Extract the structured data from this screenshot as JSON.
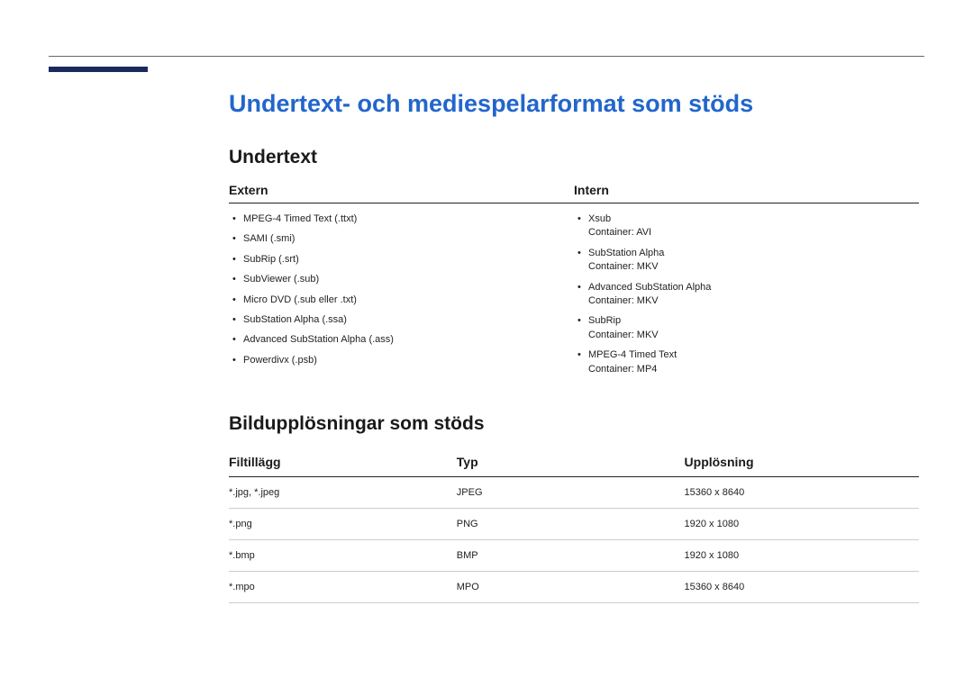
{
  "title": "Undertext- och mediespelarformat som stöds",
  "section_subtitle": "Undertext",
  "extern": {
    "heading": "Extern",
    "items": [
      "MPEG-4 Timed Text (.ttxt)",
      "SAMI (.smi)",
      "SubRip (.srt)",
      "SubViewer (.sub)",
      "Micro DVD (.sub eller .txt)",
      "SubStation Alpha (.ssa)",
      "Advanced SubStation Alpha (.ass)",
      "Powerdivx (.psb)"
    ]
  },
  "intern": {
    "heading": "Intern",
    "items": [
      {
        "name": "Xsub",
        "container": "Container: AVI"
      },
      {
        "name": "SubStation Alpha",
        "container": "Container: MKV"
      },
      {
        "name": "Advanced SubStation Alpha",
        "container": "Container: MKV"
      },
      {
        "name": "SubRip",
        "container": "Container: MKV"
      },
      {
        "name": "MPEG-4 Timed Text",
        "container": "Container: MP4"
      }
    ]
  },
  "image_section": {
    "heading": "Bildupplösningar som stöds",
    "columns": {
      "ext": "Filtillägg",
      "type": "Typ",
      "res": "Upplösning"
    },
    "rows": [
      {
        "ext": "*.jpg, *.jpeg",
        "type": "JPEG",
        "res": "15360 x 8640"
      },
      {
        "ext": "*.png",
        "type": "PNG",
        "res": "1920 x 1080"
      },
      {
        "ext": "*.bmp",
        "type": "BMP",
        "res": "1920 x 1080"
      },
      {
        "ext": "*.mpo",
        "type": "MPO",
        "res": "15360 x 8640"
      }
    ]
  }
}
